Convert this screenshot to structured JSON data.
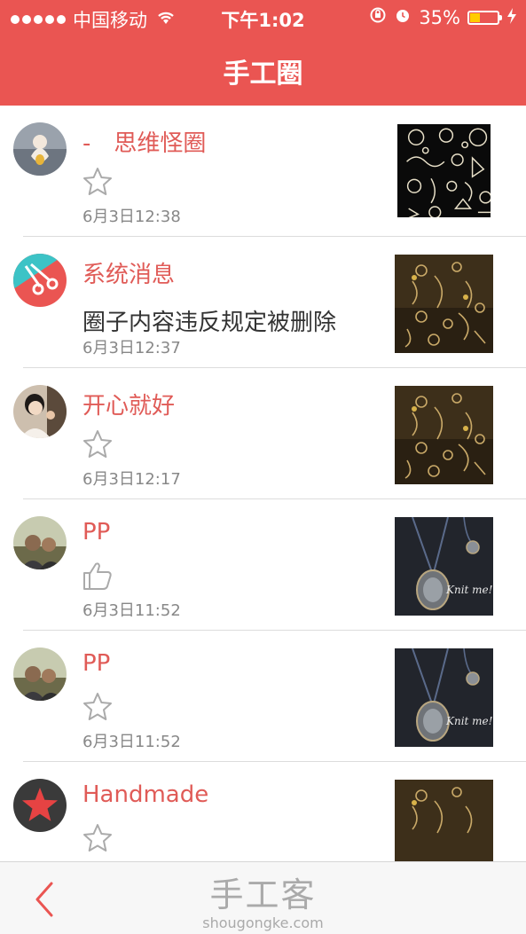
{
  "status_bar": {
    "carrier": "中国移动",
    "time": "下午1:02",
    "battery": "35%",
    "battery_level": 0.35,
    "signal_dots": 5,
    "wifi_icon": "wifi-icon",
    "lock_icon": "rotation-lock-icon",
    "alarm_icon": "alarm-icon",
    "charging_icon": "bolt-icon"
  },
  "nav": {
    "title": "手工圈"
  },
  "messages": [
    {
      "name": "-　思维怪圈",
      "reaction_icon": "star-icon",
      "text": "",
      "time": "6月3日12:38"
    },
    {
      "name": "系统消息",
      "reaction_icon": "",
      "text": "圈子内容违反规定被删除",
      "time": "6月3日12:37"
    },
    {
      "name": "开心就好",
      "reaction_icon": "star-icon",
      "text": "",
      "time": "6月3日12:17"
    },
    {
      "name": "PP",
      "reaction_icon": "thumbs-up-icon",
      "text": "",
      "time": "6月3日11:52"
    },
    {
      "name": "PP",
      "reaction_icon": "star-icon",
      "text": "",
      "time": "6月3日11:52"
    },
    {
      "name": "Handmade",
      "reaction_icon": "star-icon",
      "text": "",
      "time": ""
    }
  ],
  "footer": {
    "back_icon": "chevron-left-icon",
    "watermark_logo": "手工客",
    "watermark_url": "shougongke.com"
  },
  "colors": {
    "brand": "#ea5552",
    "name_text": "#e05b57",
    "time_text": "#888888"
  }
}
